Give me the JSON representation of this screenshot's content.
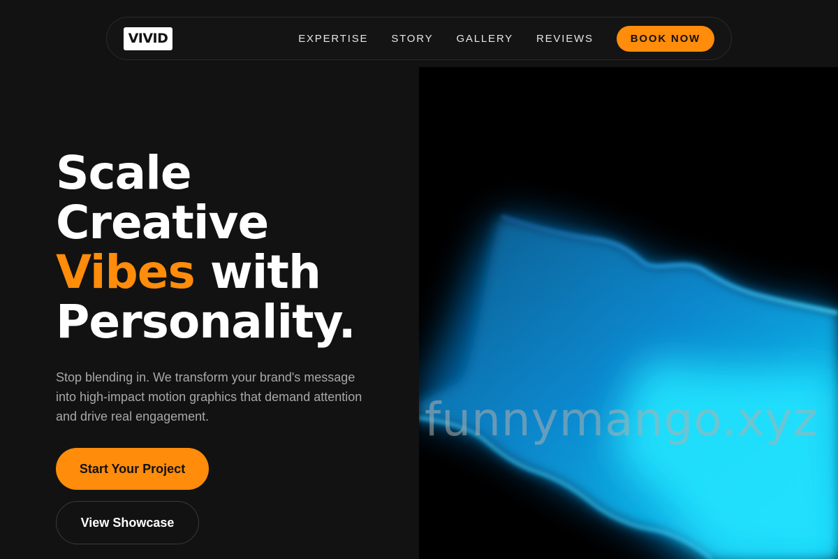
{
  "brand": {
    "logo_text": "VIVID"
  },
  "nav": {
    "links": [
      "EXPERTISE",
      "STORY",
      "GALLERY",
      "REVIEWS"
    ],
    "cta_label": "BOOK NOW"
  },
  "hero": {
    "headline_line1": "Scale",
    "headline_line2": "Creative",
    "headline_accent": "Vibes",
    "headline_line3_rest": " with",
    "headline_line4": "Personality.",
    "subtext": "Stop blending in. We transform your brand's message into high-impact motion graphics that demand attention and drive real engagement.",
    "primary_cta": "Start Your Project",
    "secondary_cta": "View Showcase"
  },
  "visual": {
    "watermark": "funnymango.xyz",
    "description_icon": "glowing-blue-wave-image"
  },
  "colors": {
    "background": "#121212",
    "accent": "#ff8c0a",
    "glow": "#00c8ff"
  }
}
